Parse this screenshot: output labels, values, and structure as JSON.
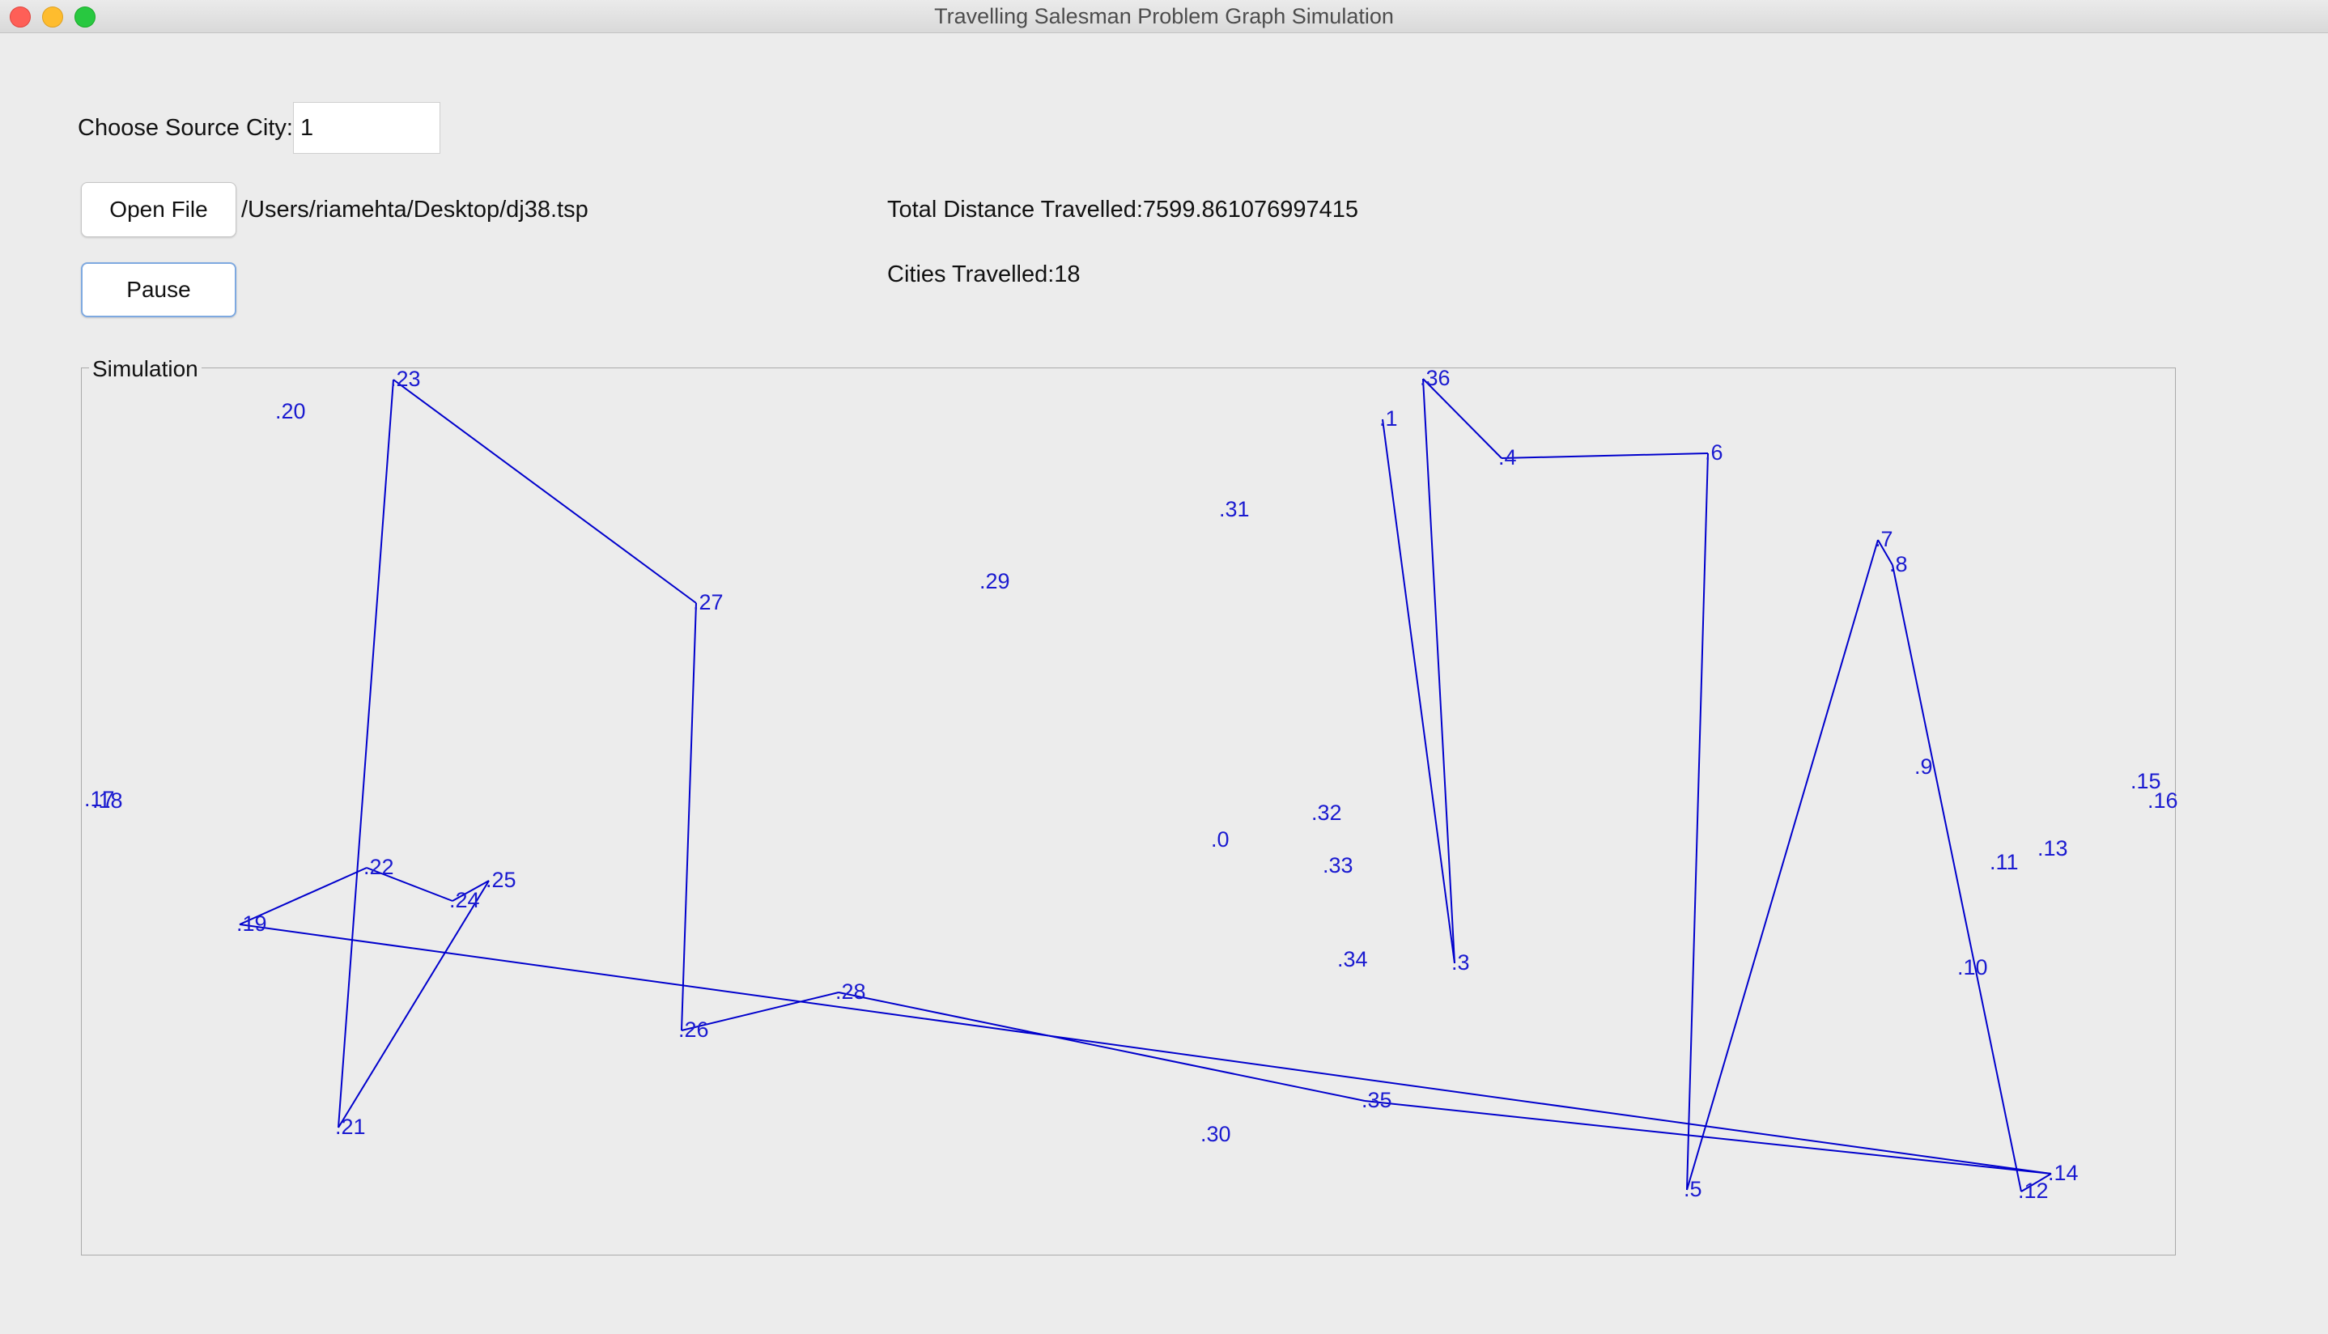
{
  "window": {
    "title": "Travelling Salesman Problem Graph Simulation"
  },
  "controls": {
    "source_label": "Choose Source City:",
    "source_value": "1",
    "open_button": "Open File",
    "file_path": "/Users/riamehta/Desktop/dj38.tsp",
    "pause_button": "Pause"
  },
  "stats": {
    "total_distance": "Total Distance Travelled:7599.861076997415",
    "cities_travelled": "Cities Travelled:18"
  },
  "simulation": {
    "title": "Simulation",
    "edge_color": "#0000cc",
    "label_color": "#1a1ad0",
    "route": [
      23,
      27,
      26,
      28,
      35,
      14,
      12,
      8,
      7,
      5,
      6,
      4,
      36,
      3,
      1
    ],
    "partial_route": [
      19,
      22,
      24,
      25,
      21,
      23
    ]
  }
}
